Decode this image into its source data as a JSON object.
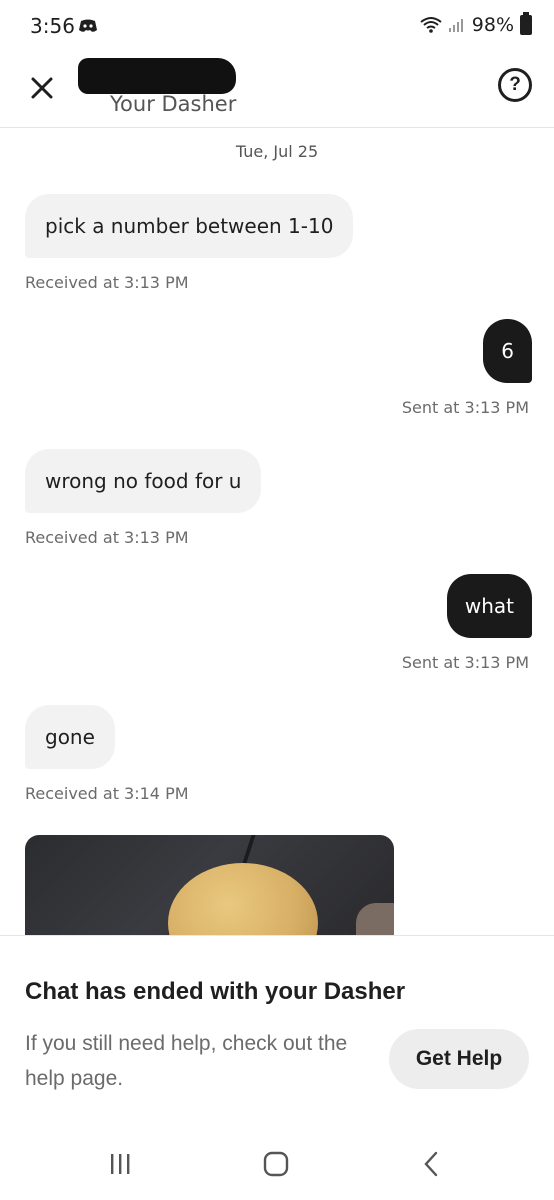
{
  "status_bar": {
    "time": "3:56",
    "battery": "98%",
    "icons": [
      "discord-icon",
      "wifi-icon",
      "signal-icon",
      "battery-icon"
    ]
  },
  "header": {
    "subtitle": "Your Dasher",
    "icons": [
      "close-icon",
      "help-icon"
    ]
  },
  "chat": {
    "date": "Tue, Jul 25",
    "messages": [
      {
        "direction": "in",
        "text": "pick a number between 1-10",
        "meta": "Received at 3:13 PM"
      },
      {
        "direction": "out",
        "text": "6",
        "meta": "Sent at 3:13 PM"
      },
      {
        "direction": "in",
        "text": "wrong no food for u",
        "meta": "Received at 3:13 PM"
      },
      {
        "direction": "out",
        "text": "what",
        "meta": "Sent at 3:13 PM"
      },
      {
        "direction": "in",
        "text": "gone",
        "meta": "Received at 3:14 PM"
      }
    ]
  },
  "footer": {
    "title": "Chat has ended with your Dasher",
    "text": "If you still need help, check out the help page.",
    "button": "Get Help"
  },
  "nav": {
    "icons": [
      "recent-apps-icon",
      "home-icon",
      "back-icon"
    ]
  },
  "colors": {
    "incoming_bubble": "#f2f2f2",
    "outgoing_bubble": "#1a1a1a",
    "meta_text": "#6b6b6b"
  }
}
